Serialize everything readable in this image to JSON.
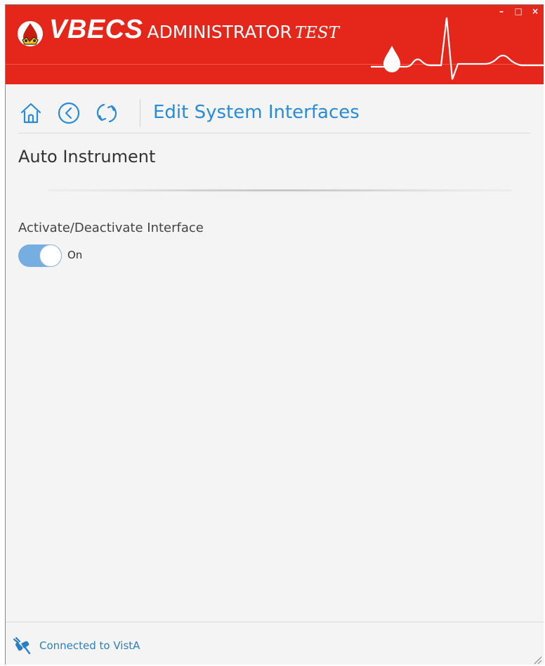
{
  "app": {
    "brand_main": "VBECS",
    "brand_role": "ADMINISTRATOR",
    "brand_env": "TEST",
    "header_color": "#e5271b",
    "window_controls": {
      "minimize": "–",
      "maximize": "□",
      "close": "×"
    }
  },
  "nav": {
    "home_icon": "home-icon",
    "back_icon": "back-circle-icon",
    "refresh_icon": "refresh-icon",
    "page_title": "Edit System Interfaces"
  },
  "section": {
    "title": "Auto Instrument"
  },
  "form": {
    "activate_label": "Activate/Deactivate Interface",
    "toggle": {
      "state": true,
      "label": "On",
      "color": "#76aee2"
    }
  },
  "status_bar": {
    "icon": "plug-connection-icon",
    "text": "Connected to VistA",
    "text_color": "#2a7fc4"
  },
  "accent_color": "#2a8bd6"
}
